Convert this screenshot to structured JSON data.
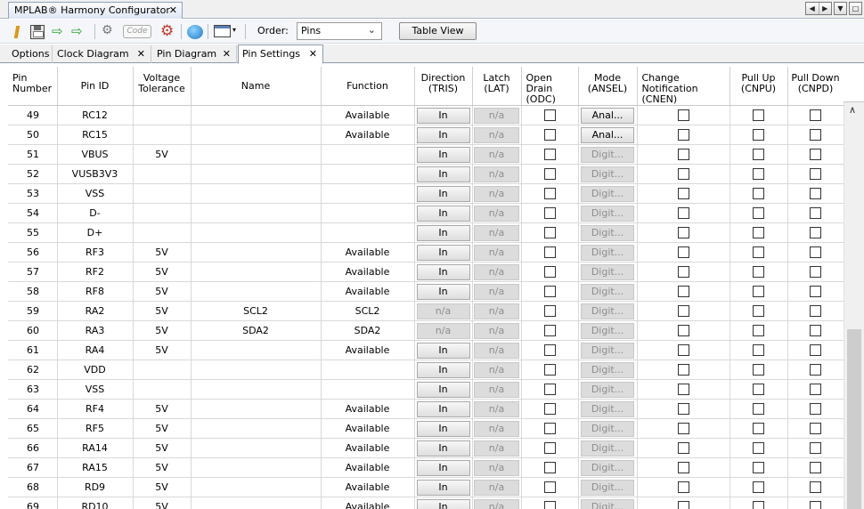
{
  "window": {
    "tab_title": "MPLAB® Harmony Configurator",
    "tab_close": "✕",
    "ctrl_prev": "◀",
    "ctrl_next": "▶",
    "ctrl_menu": "▼",
    "ctrl_restore": "□"
  },
  "toolbar": {
    "code_label": "Code",
    "order_label": "Order:",
    "order_value": "Pins",
    "table_view_label": "Table View",
    "import_glyph": "⇨",
    "export_glyph": "⇨",
    "gear_glyph": "⚙",
    "dropdown_glyph": "▾"
  },
  "subtabs": [
    {
      "label": "Options",
      "closable": false
    },
    {
      "label": "Clock Diagram",
      "closable": true
    },
    {
      "label": "Pin Diagram",
      "closable": true
    },
    {
      "label": "Pin Settings",
      "closable": true,
      "active": true
    }
  ],
  "close_glyph": "✕",
  "table": {
    "headers": [
      "Pin\nNumber",
      "Pin ID",
      "Voltage\nTolerance",
      "Name",
      "Function",
      "Direction\n(TRIS)",
      "Latch\n(LAT)",
      "Open\nDrain\n(ODC)",
      "Mode\n(ANSEL)",
      "Change\nNotification\n(CNEN)",
      "Pull Up\n(CNPU)",
      "Pull Down\n(CNPD)"
    ],
    "rows": [
      {
        "num": "49",
        "id": "RC12",
        "volt": "",
        "name": "",
        "func": "Available",
        "dir": "In",
        "dir_en": true,
        "latch": "n/a",
        "mode": "Anal...",
        "mode_en": true
      },
      {
        "num": "50",
        "id": "RC15",
        "volt": "",
        "name": "",
        "func": "Available",
        "dir": "In",
        "dir_en": true,
        "latch": "n/a",
        "mode": "Anal...",
        "mode_en": true
      },
      {
        "num": "51",
        "id": "VBUS",
        "volt": "5V",
        "name": "",
        "func": "",
        "dir": "In",
        "dir_en": true,
        "latch": "n/a",
        "mode": "Digit...",
        "mode_en": false
      },
      {
        "num": "52",
        "id": "VUSB3V3",
        "volt": "",
        "name": "",
        "func": "",
        "dir": "In",
        "dir_en": true,
        "latch": "n/a",
        "mode": "Digit...",
        "mode_en": false
      },
      {
        "num": "53",
        "id": "VSS",
        "volt": "",
        "name": "",
        "func": "",
        "dir": "In",
        "dir_en": true,
        "latch": "n/a",
        "mode": "Digit...",
        "mode_en": false
      },
      {
        "num": "54",
        "id": "D-",
        "volt": "",
        "name": "",
        "func": "",
        "dir": "In",
        "dir_en": true,
        "latch": "n/a",
        "mode": "Digit...",
        "mode_en": false
      },
      {
        "num": "55",
        "id": "D+",
        "volt": "",
        "name": "",
        "func": "",
        "dir": "In",
        "dir_en": true,
        "latch": "n/a",
        "mode": "Digit...",
        "mode_en": false
      },
      {
        "num": "56",
        "id": "RF3",
        "volt": "5V",
        "name": "",
        "func": "Available",
        "dir": "In",
        "dir_en": true,
        "latch": "n/a",
        "mode": "Digit...",
        "mode_en": false
      },
      {
        "num": "57",
        "id": "RF2",
        "volt": "5V",
        "name": "",
        "func": "Available",
        "dir": "In",
        "dir_en": true,
        "latch": "n/a",
        "mode": "Digit...",
        "mode_en": false
      },
      {
        "num": "58",
        "id": "RF8",
        "volt": "5V",
        "name": "",
        "func": "Available",
        "dir": "In",
        "dir_en": true,
        "latch": "n/a",
        "mode": "Digit...",
        "mode_en": false
      },
      {
        "num": "59",
        "id": "RA2",
        "volt": "5V",
        "name": "SCL2",
        "func": "SCL2",
        "dir": "n/a",
        "dir_en": false,
        "latch": "n/a",
        "mode": "Digit...",
        "mode_en": false
      },
      {
        "num": "60",
        "id": "RA3",
        "volt": "5V",
        "name": "SDA2",
        "func": "SDA2",
        "dir": "n/a",
        "dir_en": false,
        "latch": "n/a",
        "mode": "Digit...",
        "mode_en": false
      },
      {
        "num": "61",
        "id": "RA4",
        "volt": "5V",
        "name": "",
        "func": "Available",
        "dir": "In",
        "dir_en": true,
        "latch": "n/a",
        "mode": "Digit...",
        "mode_en": false
      },
      {
        "num": "62",
        "id": "VDD",
        "volt": "",
        "name": "",
        "func": "",
        "dir": "In",
        "dir_en": true,
        "latch": "n/a",
        "mode": "Digit...",
        "mode_en": false
      },
      {
        "num": "63",
        "id": "VSS",
        "volt": "",
        "name": "",
        "func": "",
        "dir": "In",
        "dir_en": true,
        "latch": "n/a",
        "mode": "Digit...",
        "mode_en": false
      },
      {
        "num": "64",
        "id": "RF4",
        "volt": "5V",
        "name": "",
        "func": "Available",
        "dir": "In",
        "dir_en": true,
        "latch": "n/a",
        "mode": "Digit...",
        "mode_en": false
      },
      {
        "num": "65",
        "id": "RF5",
        "volt": "5V",
        "name": "",
        "func": "Available",
        "dir": "In",
        "dir_en": true,
        "latch": "n/a",
        "mode": "Digit...",
        "mode_en": false
      },
      {
        "num": "66",
        "id": "RA14",
        "volt": "5V",
        "name": "",
        "func": "Available",
        "dir": "In",
        "dir_en": true,
        "latch": "n/a",
        "mode": "Digit...",
        "mode_en": false
      },
      {
        "num": "67",
        "id": "RA15",
        "volt": "5V",
        "name": "",
        "func": "Available",
        "dir": "In",
        "dir_en": true,
        "latch": "n/a",
        "mode": "Digit...",
        "mode_en": false
      },
      {
        "num": "68",
        "id": "RD9",
        "volt": "5V",
        "name": "",
        "func": "Available",
        "dir": "In",
        "dir_en": true,
        "latch": "n/a",
        "mode": "Digit...",
        "mode_en": false
      },
      {
        "num": "69",
        "id": "RD10",
        "volt": "5V",
        "name": "",
        "func": "Available",
        "dir": "In",
        "dir_en": true,
        "latch": "n/a",
        "mode": "Digit...",
        "mode_en": false
      }
    ]
  },
  "scrollbar": {
    "up_glyph": "∧"
  }
}
